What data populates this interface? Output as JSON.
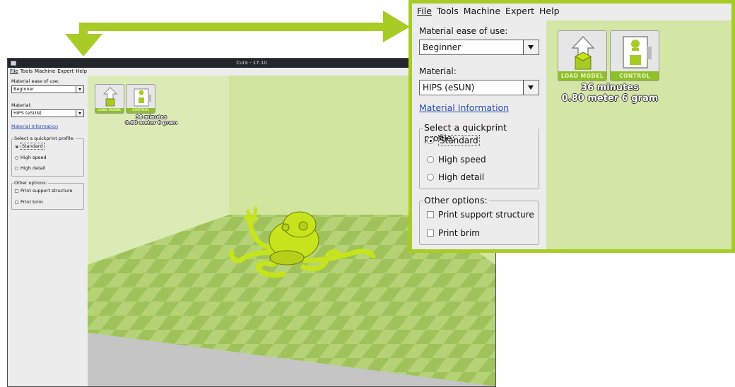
{
  "window": {
    "title": "Cura - 17.10"
  },
  "menu": {
    "file": "File",
    "tools": "Tools",
    "machine": "Machine",
    "expert": "Expert",
    "help": "Help"
  },
  "sidebar": {
    "ease_label": "Material ease of use:",
    "ease_value": "Beginner",
    "material_label": "Material:",
    "material_value": "HIPS (eSUN)",
    "material_info_link": "Material Information",
    "quickprint_label": "Select a quickprint profile:",
    "profiles": [
      {
        "label": "Standard",
        "selected": true
      },
      {
        "label": "High speed",
        "selected": false
      },
      {
        "label": "High detail",
        "selected": false
      }
    ],
    "other_label": "Other options:",
    "options": [
      {
        "label": "Print support structure",
        "checked": false
      },
      {
        "label": "Print brim",
        "checked": false
      }
    ]
  },
  "toolbar": {
    "load_model": "LOAD MODEL",
    "control": "CONTROL"
  },
  "estimate": {
    "time": "36 minutes",
    "material": "0.80 meter 6 gram"
  },
  "colors": {
    "accent": "#a7cc26",
    "viewport_bg": "#d4e6a6",
    "model": "#c7e31c",
    "link": "#2a4fb0"
  }
}
